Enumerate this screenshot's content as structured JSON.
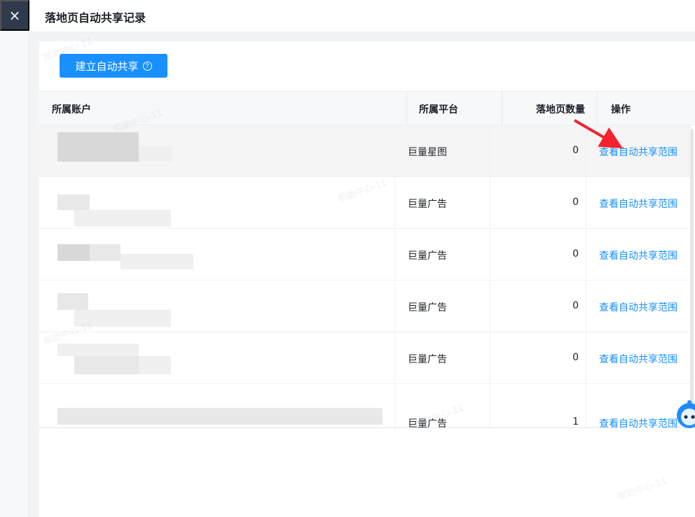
{
  "window": {
    "title": "落地页自动共享记录",
    "close_icon": "×"
  },
  "toolbar": {
    "create_label": "建立自动共享",
    "help_icon": "?"
  },
  "table": {
    "headers": [
      "所属账户",
      "所属平台",
      "落地页数量",
      "操作"
    ],
    "rows": [
      {
        "platform": "巨量星图",
        "count": "0",
        "action": "查看自动共享范围"
      },
      {
        "platform": "巨量广告",
        "count": "0",
        "action": "查看自动共享范围"
      },
      {
        "platform": "巨量广告",
        "count": "0",
        "action": "查看自动共享范围"
      },
      {
        "platform": "巨量广告",
        "count": "0",
        "action": "查看自动共享范围"
      },
      {
        "platform": "巨量广告",
        "count": "0",
        "action": "查看自动共享范围"
      },
      {
        "platform": "巨量广告",
        "count": "1",
        "action": "查看自动共享范围"
      }
    ]
  },
  "watermarks": [
    "帮助中心-11",
    "帮助中心-11",
    "帮助中心-11",
    "帮助中心-11",
    "帮助中心-11",
    "帮助中心-11"
  ],
  "colors": {
    "primary": "#1890ff",
    "close_bg": "#2f3b4c",
    "annotation": "#f5222d"
  }
}
